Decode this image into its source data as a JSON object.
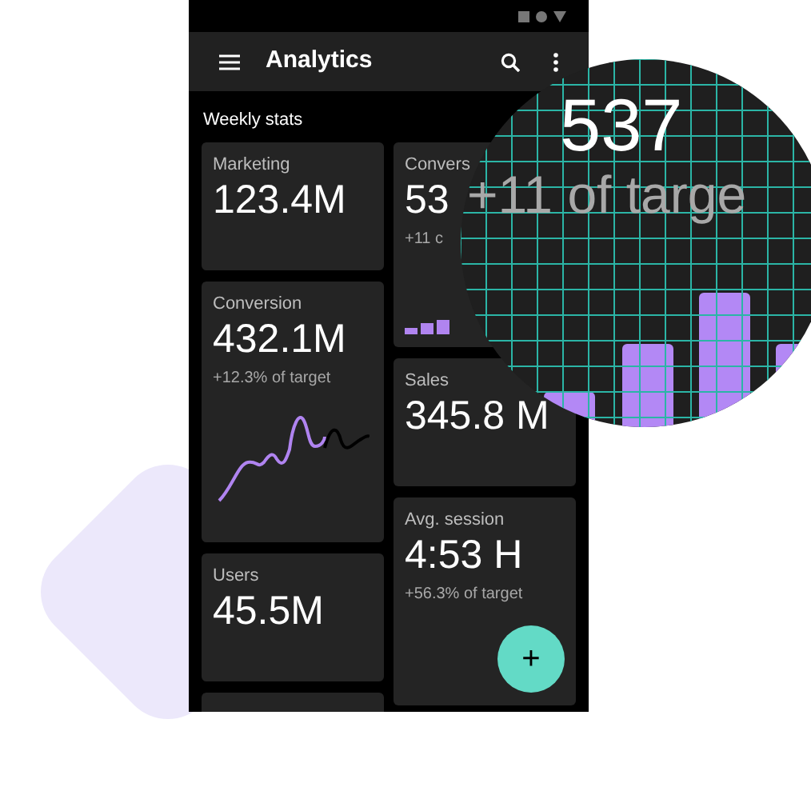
{
  "app_bar": {
    "title": "Analytics"
  },
  "section_title": "Weekly stats",
  "columns": [
    [
      {
        "kind": "stat",
        "label": "Marketing",
        "value": "123.4M"
      },
      {
        "kind": "sparkline",
        "label": "Conversion",
        "value": "432.1M",
        "note": "+12.3% of target"
      },
      {
        "kind": "stat",
        "label": "Users",
        "value": "45.5M"
      },
      {
        "kind": "blank"
      }
    ],
    [
      {
        "kind": "bars",
        "label": "Convers",
        "value": "53",
        "note": "+11 c"
      },
      {
        "kind": "stat",
        "label": "Sales",
        "value": "345.8 M"
      },
      {
        "kind": "fab",
        "label": "Avg. session",
        "value": "4:53 H",
        "note": "+56.3% of target",
        "action": "+"
      }
    ]
  ],
  "magnifier": {
    "value": "537",
    "note": "+11 of targe"
  }
}
